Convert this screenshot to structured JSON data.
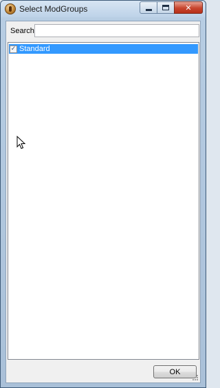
{
  "window": {
    "title": "Select ModGroups",
    "minimize_icon": "minimize-icon",
    "maximize_icon": "maximize-icon",
    "close_icon": "close-icon"
  },
  "search": {
    "label": "Search",
    "value": "",
    "placeholder": ""
  },
  "list": {
    "items": [
      {
        "label": "Standard",
        "checked": true,
        "selected": true
      }
    ]
  },
  "footer": {
    "ok_label": "OK"
  },
  "colors": {
    "selection": "#3399ff",
    "client_bg": "#f0f0f0",
    "list_bg": "#ffffff"
  }
}
